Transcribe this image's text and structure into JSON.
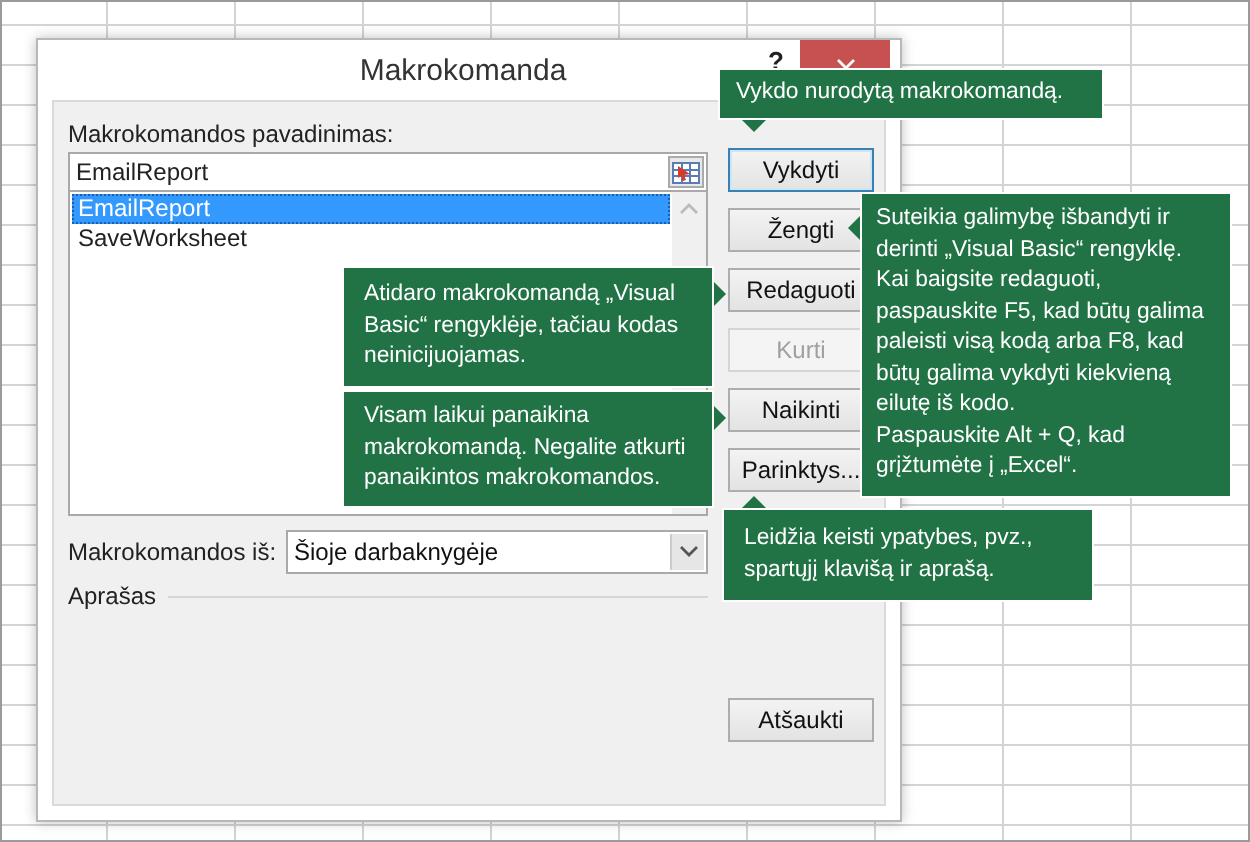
{
  "window": {
    "title": "Makrokomanda",
    "help": "?"
  },
  "name_field": {
    "label": "Makrokomandos pavadinimas:",
    "value": "EmailReport"
  },
  "macros": [
    {
      "name": "EmailReport",
      "selected": true
    },
    {
      "name": "SaveWorksheet",
      "selected": false
    }
  ],
  "buttons": [
    {
      "label": "Vykdyti",
      "disabled": false,
      "focused": true
    },
    {
      "label": "Žengti",
      "disabled": false,
      "focused": false
    },
    {
      "label": "Redaguoti",
      "disabled": false,
      "focused": false
    },
    {
      "label": "Kurti",
      "disabled": true,
      "focused": false
    },
    {
      "label": "Naikinti",
      "disabled": false,
      "focused": false
    },
    {
      "label": "Parinktys...",
      "disabled": false,
      "focused": false
    }
  ],
  "macros_in": {
    "label": "Makrokomandos iš:",
    "value": "Šioje darbaknygėje"
  },
  "description": {
    "label": "Aprašas"
  },
  "cancel_button": {
    "label": "Atšaukti"
  },
  "callouts": [
    {
      "text": "Vykdo nurodytą makrokomandą."
    },
    {
      "text": "Suteikia galimybę išbandyti ir derinti „Visual Basic“ rengyklę. Kai baigsite redaguoti, paspauskite F5, kad būtų galima paleisti visą kodą arba F8, kad būtų galima vykdyti kiekvieną eilutę iš kodo.\nPaspauskite Alt + Q, kad grįžtumėte į „Excel“."
    },
    {
      "text": "Atidaro makrokomandą „Visual Basic“ rengyklėje, tačiau kodas neinicijuojamas."
    },
    {
      "text": "Visam laikui panaikina makrokomandą. Negalite atkurti panaikintos makrokomandos."
    },
    {
      "text": "Leidžia keisti ypatybes, pvz., spartųjį klavišą ir aprašą."
    }
  ]
}
